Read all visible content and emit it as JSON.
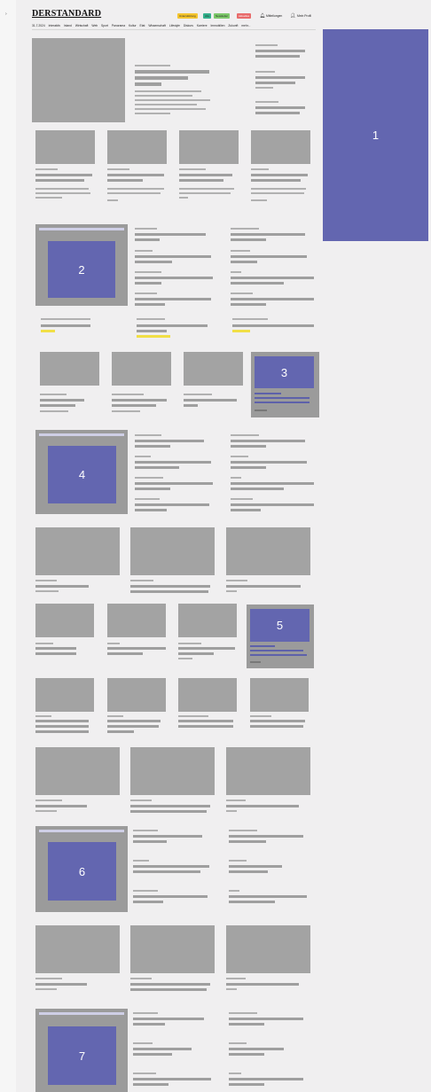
{
  "header": {
    "logo": "DERSTANDARD",
    "date": "31.7.2024",
    "nav_items": [
      "Interaktiv",
      "Inland",
      "Wirtschaft",
      "Web",
      "Sport",
      "Panorama",
      "Kultur",
      "Etat",
      "Wissenschaft",
      "Lifestyle",
      "Diskurs",
      "Karriere",
      "Immobilien",
      "Zukunft",
      "mehr..."
    ],
    "pills": [
      {
        "label": "Unterstützung",
        "color": "#f4c52f"
      },
      {
        "label": "Abo",
        "color": "#33b08c"
      },
      {
        "label": "Newsletter",
        "color": "#7cc86a"
      },
      {
        "label": "Aktuelles",
        "color": "#e86b6b"
      }
    ],
    "messages_label": "Mitteilungen",
    "profile_label": "Mein Profil"
  },
  "ads": [
    "1",
    "2",
    "3",
    "4",
    "5",
    "6",
    "7"
  ]
}
